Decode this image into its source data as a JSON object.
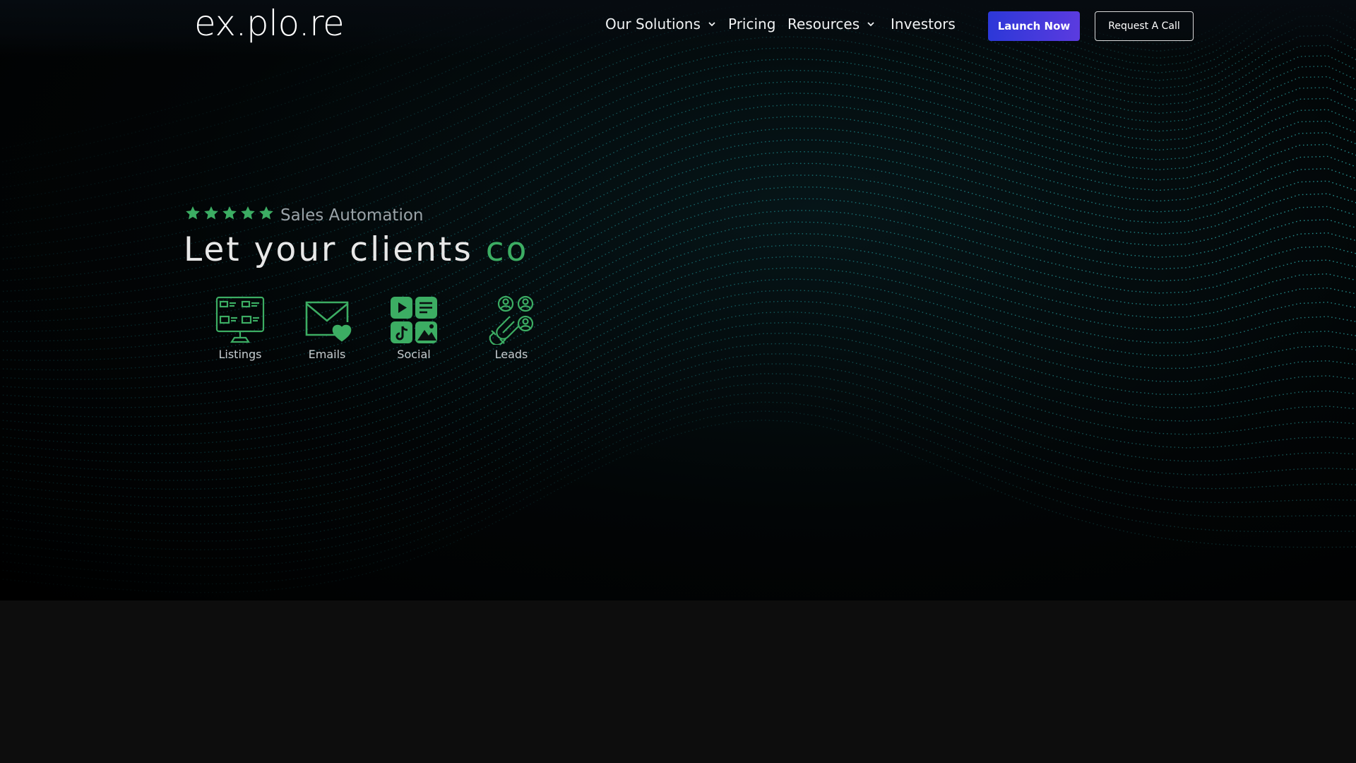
{
  "header": {
    "logo": "ex.plo.re",
    "nav": [
      {
        "label": "Our Solutions",
        "has_dropdown": true
      },
      {
        "label": "Pricing",
        "has_dropdown": false
      },
      {
        "label": "Resources",
        "has_dropdown": true
      },
      {
        "label": "Investors",
        "has_dropdown": false
      }
    ],
    "launch_button": "Launch Now",
    "call_button": "Request A Call"
  },
  "hero": {
    "rating_stars": 5,
    "tagline": "Sales Automation",
    "headline_prefix": "Let your clients",
    "headline_accent": "co",
    "features": [
      {
        "label": "Listings",
        "icon": "monitor-listings-icon"
      },
      {
        "label": "Emails",
        "icon": "envelope-heart-icon"
      },
      {
        "label": "Social",
        "icon": "social-media-icon"
      },
      {
        "label": "Leads",
        "icon": "magnet-leads-icon"
      }
    ]
  },
  "colors": {
    "accent_green": "#3cad63",
    "launch_gradient_start": "#2c38d8",
    "launch_gradient_end": "#5b3bdf",
    "wave": "#1fb3b8"
  }
}
